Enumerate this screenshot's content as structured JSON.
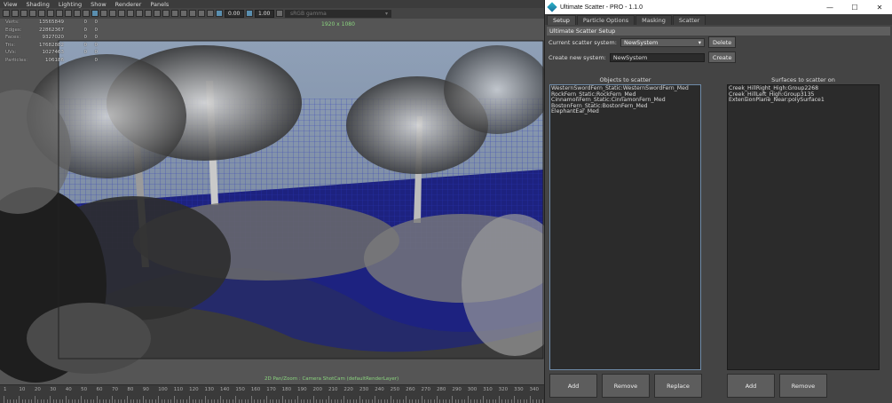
{
  "viewport": {
    "menu": [
      "View",
      "Shading",
      "Lighting",
      "Show",
      "Renderer",
      "Panels"
    ],
    "toolbar": {
      "value_a": "0.00",
      "value_b": "1.00",
      "gamma": "sRGB gamma"
    },
    "resolution": "1920 x 1080",
    "camera_label": "2D Pan/Zoom : Camera ShotCam (defaultRenderLayer)",
    "stats": [
      {
        "label": "Verts:",
        "v1": "13565849",
        "v2": "0",
        "v3": "0"
      },
      {
        "label": "Edges:",
        "v1": "22862367",
        "v2": "0",
        "v3": "0"
      },
      {
        "label": "Faces:",
        "v1": "9327020",
        "v2": "0",
        "v3": "0"
      },
      {
        "label": "Tris:",
        "v1": "17682882",
        "v2": "0",
        "v3": "0"
      },
      {
        "label": "UVs:",
        "v1": "1027463",
        "v2": "0",
        "v3": "0"
      },
      {
        "label": "Particles:",
        "v1": "106186",
        "v2": "",
        "v3": "0"
      }
    ],
    "timeline_ticks": [
      "1",
      "10",
      "20",
      "30",
      "40",
      "50",
      "60",
      "70",
      "80",
      "90",
      "100",
      "110",
      "120",
      "130",
      "140",
      "150",
      "160",
      "170",
      "180",
      "190",
      "200",
      "210",
      "220",
      "230",
      "240",
      "250",
      "260",
      "270",
      "280",
      "290",
      "300",
      "310",
      "320",
      "330",
      "340"
    ]
  },
  "scatter": {
    "title": "Ultimate Scatter - PRO - 1.1.0",
    "win_controls": {
      "minimize": "—",
      "maximize": "☐",
      "close": "✕"
    },
    "tabs": [
      "Setup",
      "Particle Options",
      "Masking",
      "Scatter"
    ],
    "active_tab": "Setup",
    "section_title": "Ultimate Scatter Setup",
    "current_system_label": "Current scatter system:",
    "current_system_value": "NewSystem",
    "delete_label": "Delete",
    "create_label_text": "Create new system:",
    "create_input_value": "NewSystem",
    "create_button": "Create",
    "objects_title": "Objects to scatter",
    "objects": [
      "WesternSwordFern_Static:WesternSwordFern_Med",
      "RockFern_Static:RockFern_Med",
      "CinnamonFern_Static:CinnamonFern_Med",
      "BostonFern_Static:BostonFern_Med",
      "ElephantEar_Med"
    ],
    "surfaces_title": "Surfaces to scatter on",
    "surfaces": [
      "Creek_HillRight_High:Group2268",
      "Creek_HillLeft_High:Group3135",
      "ExtensionPlane_Near:polySurface1"
    ],
    "obj_buttons": {
      "add": "Add",
      "remove": "Remove",
      "replace": "Replace"
    },
    "surf_buttons": {
      "add": "Add",
      "remove": "Remove"
    }
  }
}
